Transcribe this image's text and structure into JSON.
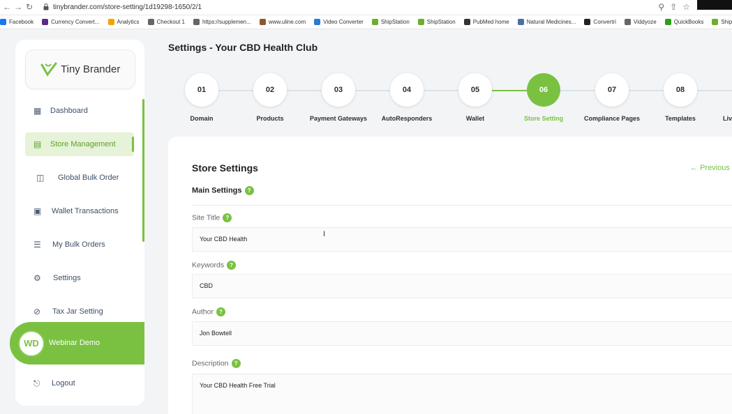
{
  "browser": {
    "url": "tinybrander.com/store-setting/1d19298-1650/2/1",
    "bookmarks": [
      {
        "label": "Facebook",
        "color": "#1877f2"
      },
      {
        "label": "Currency Convert...",
        "color": "#5b2a86"
      },
      {
        "label": "Analytics",
        "color": "#f4a300"
      },
      {
        "label": "Checkout 1",
        "color": "#666666"
      },
      {
        "label": "https://supplemen...",
        "color": "#666666"
      },
      {
        "label": "www.uline.com",
        "color": "#8b5a2b"
      },
      {
        "label": "Video Converter",
        "color": "#2a7ad6"
      },
      {
        "label": "ShipStation",
        "color": "#6fae2d"
      },
      {
        "label": "ShipStation",
        "color": "#6fae2d"
      },
      {
        "label": "PubMed home",
        "color": "#333333"
      },
      {
        "label": "Natural Medicines...",
        "color": "#4a6fa5"
      },
      {
        "label": "Convertri",
        "color": "#222222"
      },
      {
        "label": "Viddyoze",
        "color": "#666666"
      },
      {
        "label": "QuickBooks",
        "color": "#2ca01c"
      },
      {
        "label": "ShipS",
        "color": "#6fae2d"
      }
    ]
  },
  "sidebar": {
    "brand": "Tiny Brander",
    "items": [
      {
        "label": "Dashboard",
        "icon": "dashboard-icon"
      },
      {
        "label": "Store Management",
        "icon": "store-icon",
        "active": true
      },
      {
        "label": "Global Bulk Order",
        "icon": "bulk-order-icon"
      },
      {
        "label": "Wallet Transactions",
        "icon": "wallet-icon"
      },
      {
        "label": "My Bulk Orders",
        "icon": "list-icon"
      },
      {
        "label": "Settings",
        "icon": "gear-icon"
      },
      {
        "label": "Tax Jar Setting",
        "icon": "tax-icon"
      }
    ],
    "user": {
      "initials": "WD",
      "name": "Webinar Demo"
    },
    "logout": "Logout"
  },
  "page": {
    "title": "Settings - Your CBD Health Club"
  },
  "stepper": {
    "steps": [
      {
        "num": "01",
        "label": "Domain"
      },
      {
        "num": "02",
        "label": "Products"
      },
      {
        "num": "03",
        "label": "Payment Gateways"
      },
      {
        "num": "04",
        "label": "AutoResponders"
      },
      {
        "num": "05",
        "label": "Wallet"
      },
      {
        "num": "06",
        "label": "Store Setting",
        "active": true
      },
      {
        "num": "07",
        "label": "Compliance Pages"
      },
      {
        "num": "08",
        "label": "Templates"
      },
      {
        "num": "",
        "label": "Liv"
      }
    ]
  },
  "form": {
    "title": "Store Settings",
    "previous": "Previous",
    "section": "Main Settings",
    "fields": [
      {
        "label": "Site Title",
        "value": "Your CBD Health"
      },
      {
        "label": "Keywords",
        "value": "CBD"
      },
      {
        "label": "Author",
        "value": "Jon Bowtell"
      },
      {
        "label": "Description",
        "value": "Your CBD Health Free Trial"
      }
    ]
  },
  "colors": {
    "accent": "#7ac142",
    "sidebar_text": "#3c4f69"
  }
}
